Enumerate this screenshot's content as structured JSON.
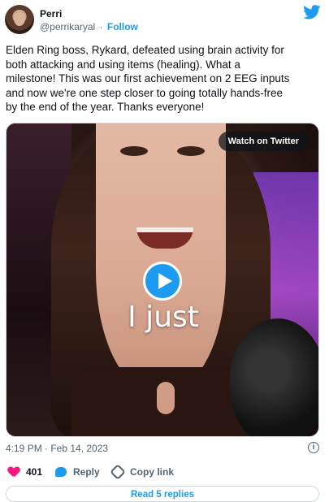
{
  "header": {
    "name": "Perri",
    "handle": "@perrikaryal",
    "separator": "·",
    "follow_label": "Follow"
  },
  "tweet": {
    "lines": [
      "Elden Ring boss, Rykard, defeated using brain activity for",
      "both attacking and using items (healing). What a",
      "milestone! This was our first achievement on 2 EEG inputs",
      "and now we're one step closer to going totally hands-free",
      "by the end of the year. Thanks everyone!"
    ]
  },
  "media": {
    "watch_label": "Watch on Twitter",
    "caption": "I just"
  },
  "meta": {
    "timestamp": "4:19 PM · Feb 14, 2023",
    "info_icon": "i"
  },
  "actions": {
    "like_count": "401",
    "reply_label": "Reply",
    "copy_label": "Copy link"
  },
  "replies_label": "Read 5 replies",
  "colors": {
    "accent": "#1d9bf0",
    "like": "#f91880",
    "text": "#0f1419",
    "muted": "#536471"
  }
}
